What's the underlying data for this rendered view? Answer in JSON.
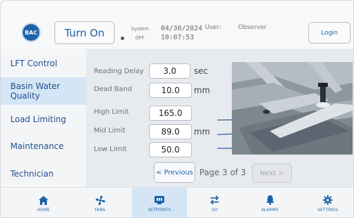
{
  "header": {
    "logo_text": "BAC",
    "turn_on_label": "Turn On",
    "system_label": "System",
    "system_state": "OFF",
    "date": "04/30/2024",
    "time": "10:07:53",
    "user_label": "User:",
    "user_name": "Observer",
    "login_label": "Login"
  },
  "sidebar": {
    "items": [
      {
        "label": "LFT Control"
      },
      {
        "label": "Basin Water Quality"
      },
      {
        "label": "Load Limiting"
      },
      {
        "label": "Maintenance"
      },
      {
        "label": "Technician"
      }
    ]
  },
  "settings": {
    "reading_delay": {
      "label": "Reading Delay",
      "value": "3.0",
      "unit": "sec"
    },
    "dead_band": {
      "label": "Dead Band",
      "value": "10.0",
      "unit": "mm"
    },
    "high_limit": {
      "label": "High Limit",
      "value": "165.0"
    },
    "mid_limit": {
      "label": "Mid Limit",
      "value": "89.0",
      "unit": "mm"
    },
    "low_limit": {
      "label": "Low Limit",
      "value": "50.0"
    }
  },
  "pager": {
    "previous_label": "< Previous",
    "page_text": "Page 3 of 3",
    "next_label": "Next >"
  },
  "bottom_nav": {
    "items": [
      {
        "label": "HOME",
        "icon": "home-icon"
      },
      {
        "label": "FANS",
        "icon": "fan-icon"
      },
      {
        "label": "SETPOINTS",
        "icon": "setpoints-icon"
      },
      {
        "label": "I/O",
        "icon": "io-arrows-icon"
      },
      {
        "label": "ALARMS",
        "icon": "bell-icon"
      },
      {
        "label": "SETTINGS",
        "icon": "gear-icon"
      }
    ]
  },
  "colors": {
    "accent": "#1b62a8",
    "active_bg": "#d4e6f6",
    "panel_bg": "#e7eaee"
  }
}
